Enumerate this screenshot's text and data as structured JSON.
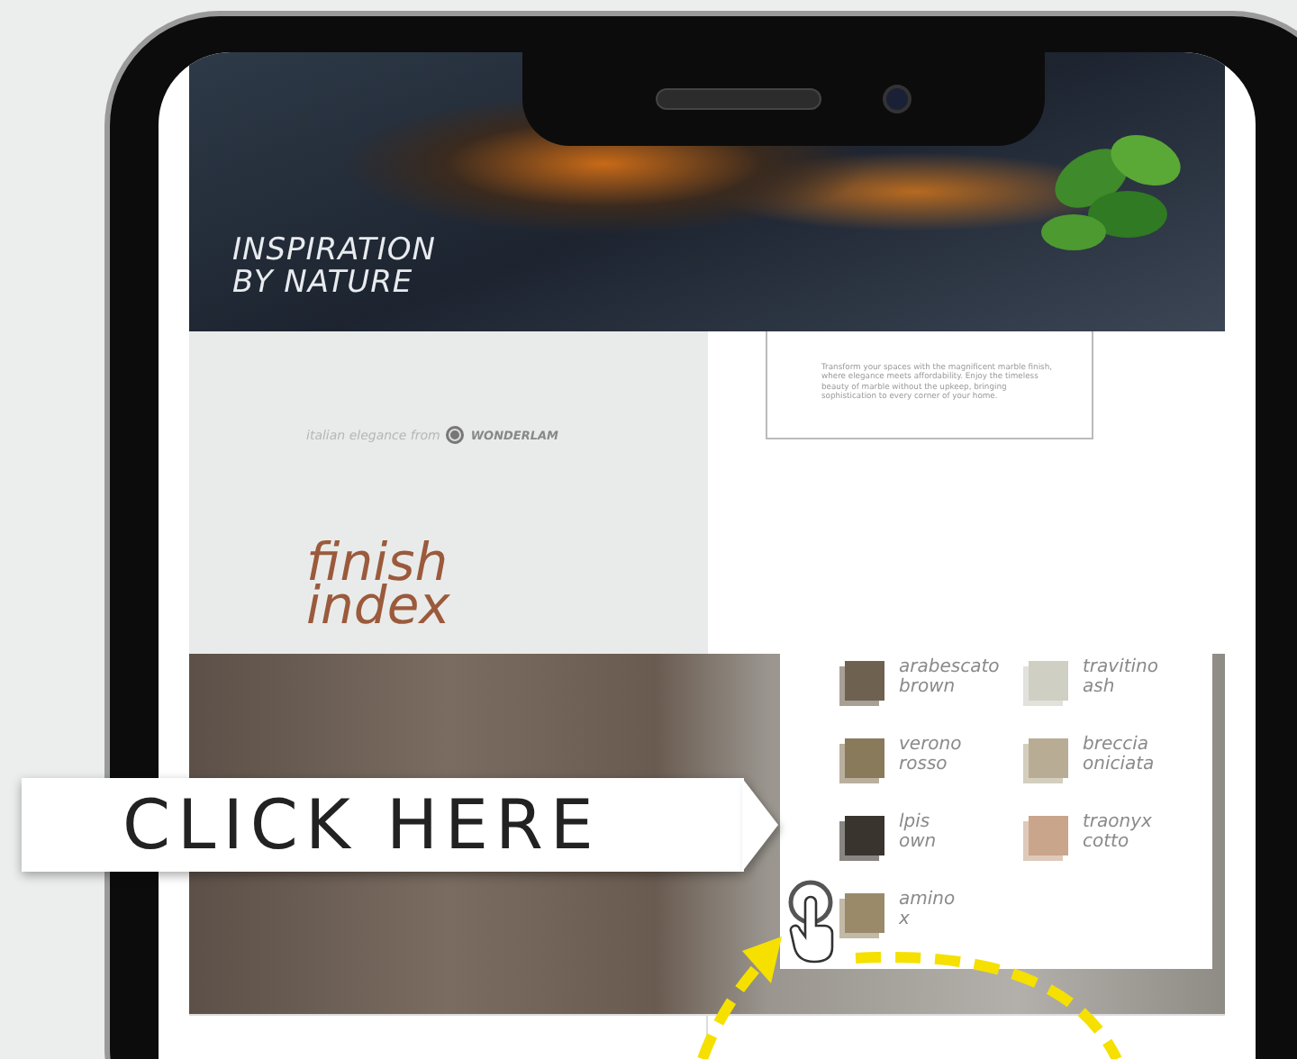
{
  "hero": {
    "title_lines": [
      "INSPIRATION",
      "BY NATURE"
    ]
  },
  "intro": {
    "text": "Transform your spaces with the magnificent marble finish, where elegance meets affordability. Enjoy the timeless beauty of marble without the upkeep, bringing sophistication to every corner of your home."
  },
  "brand": {
    "tagline": "italian elegance from",
    "name": "WONDERLAM"
  },
  "section": {
    "title_lines": [
      "finish",
      "index"
    ]
  },
  "finishes": [
    {
      "name_lines": [
        "arabescato",
        "brown"
      ],
      "color": "#6e6150"
    },
    {
      "name_lines": [
        "travitino",
        "ash"
      ],
      "color": "#cfcfc4"
    },
    {
      "name_lines": [
        "verono",
        "rosso"
      ],
      "color": "#8a7a5c"
    },
    {
      "name_lines": [
        "breccia",
        "oniciata"
      ],
      "color": "#b8ad94"
    },
    {
      "name_lines": [
        "lpis",
        "own"
      ],
      "color": "#3a342e"
    },
    {
      "name_lines": [
        "traonyx",
        "cotto"
      ],
      "color": "#c9a58c"
    },
    {
      "name_lines": [
        "amino",
        "x"
      ],
      "color": "#9a8a6a"
    }
  ],
  "cta": {
    "label": "CLICK HERE"
  }
}
